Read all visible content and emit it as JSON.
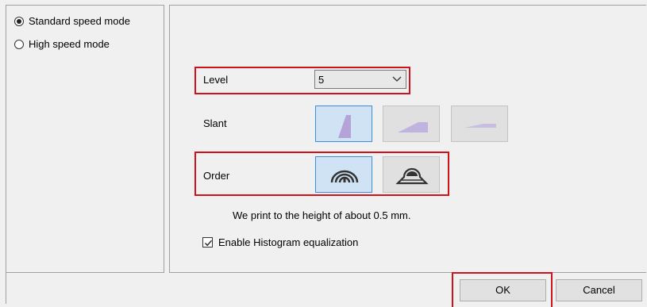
{
  "modes": {
    "options": [
      {
        "label": "Standard speed mode",
        "checked": true
      },
      {
        "label": "High speed mode",
        "checked": false
      }
    ]
  },
  "settings": {
    "level_label": "Level",
    "level_value": "5",
    "slant_label": "Slant",
    "slant_options": [
      {
        "icon": "slant-steep-icon",
        "selected": true
      },
      {
        "icon": "slant-medium-icon",
        "selected": false
      },
      {
        "icon": "slant-shallow-icon",
        "selected": false
      }
    ],
    "order_label": "Order",
    "order_options": [
      {
        "icon": "order-concentric-arches-icon",
        "selected": true
      },
      {
        "icon": "order-dome-layers-icon",
        "selected": false
      }
    ],
    "height_note": "We print to the height of about 0.5 mm.",
    "histogram_label": "Enable Histogram equalization",
    "histogram_checked": true
  },
  "buttons": {
    "ok": "OK",
    "cancel": "Cancel"
  },
  "colors": {
    "highlight_red": "#d0121b",
    "selected_blue": "#cfe3f5",
    "icon_purple": "#b4a3d6"
  }
}
